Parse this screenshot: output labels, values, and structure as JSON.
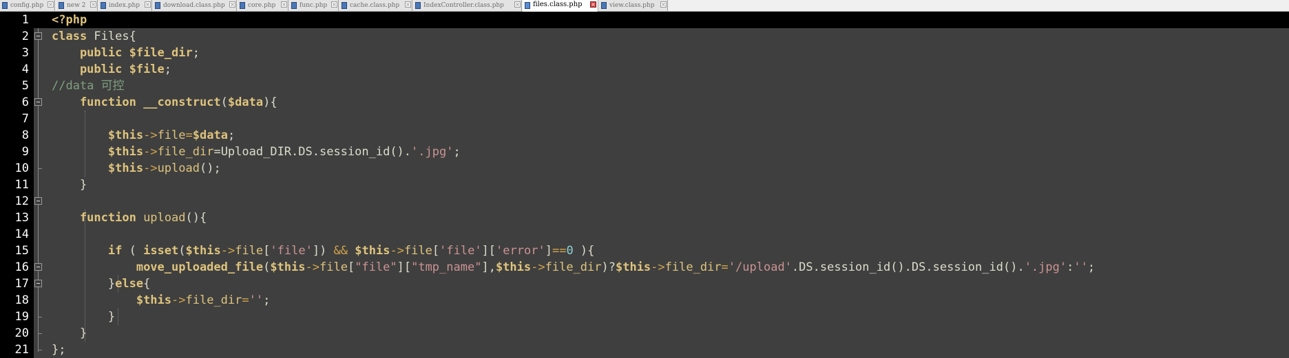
{
  "tabs": [
    {
      "label": "config.php",
      "active": false
    },
    {
      "label": "new 2",
      "active": false
    },
    {
      "label": "index.php",
      "active": false
    },
    {
      "label": "download.class.php",
      "active": false
    },
    {
      "label": "core.php",
      "active": false
    },
    {
      "label": "func.php",
      "active": false
    },
    {
      "label": "cache.class.php",
      "active": false
    },
    {
      "label": "IndexController.class.php",
      "active": false
    },
    {
      "label": "files.class.php",
      "active": true
    },
    {
      "label": "view.class.php",
      "active": false
    }
  ],
  "close_glyph": "×",
  "line_numbers": [
    "1",
    "2",
    "3",
    "4",
    "5",
    "6",
    "7",
    "8",
    "9",
    "10",
    "11",
    "12",
    "13",
    "14",
    "15",
    "16",
    "17",
    "18",
    "19",
    "20",
    "21"
  ],
  "code_lines": [
    [
      {
        "t": "<?php",
        "c": "kw"
      }
    ],
    [
      {
        "t": "class ",
        "c": "kw"
      },
      {
        "t": "Files{",
        "c": "plain"
      }
    ],
    [
      {
        "t": "    public ",
        "c": "kw"
      },
      {
        "t": "$file_dir",
        "c": "var"
      },
      {
        "t": ";",
        "c": "plain"
      }
    ],
    [
      {
        "t": "    public ",
        "c": "kw"
      },
      {
        "t": "$file",
        "c": "var"
      },
      {
        "t": ";",
        "c": "plain"
      }
    ],
    [
      {
        "t": "//data 可控",
        "c": "cmt"
      }
    ],
    [
      {
        "t": "    function ",
        "c": "kw"
      },
      {
        "t": "__construct",
        "c": "fn"
      },
      {
        "t": "(",
        "c": "plain"
      },
      {
        "t": "$data",
        "c": "var"
      },
      {
        "t": "){",
        "c": "plain"
      }
    ],
    [],
    [
      {
        "t": "        ",
        "c": "plain"
      },
      {
        "t": "$this",
        "c": "var"
      },
      {
        "t": "->",
        "c": "op"
      },
      {
        "t": "file",
        "c": "prop"
      },
      {
        "t": "=",
        "c": "op"
      },
      {
        "t": "$data",
        "c": "var"
      },
      {
        "t": ";",
        "c": "plain"
      }
    ],
    [
      {
        "t": "        ",
        "c": "plain"
      },
      {
        "t": "$this",
        "c": "var"
      },
      {
        "t": "->",
        "c": "op"
      },
      {
        "t": "file_dir",
        "c": "prop"
      },
      {
        "t": "=Upload_DIR.DS.session_id().",
        "c": "plain"
      },
      {
        "t": "'.jpg'",
        "c": "str"
      },
      {
        "t": ";",
        "c": "plain"
      }
    ],
    [
      {
        "t": "        ",
        "c": "plain"
      },
      {
        "t": "$this",
        "c": "var"
      },
      {
        "t": "->",
        "c": "op"
      },
      {
        "t": "upload",
        "c": "prop"
      },
      {
        "t": "();",
        "c": "plain"
      }
    ],
    [
      {
        "t": "    }",
        "c": "plain"
      }
    ],
    [],
    [
      {
        "t": "    function ",
        "c": "kw"
      },
      {
        "t": "upload",
        "c": "prop"
      },
      {
        "t": "(){",
        "c": "plain"
      }
    ],
    [],
    [
      {
        "t": "        if ",
        "c": "kw"
      },
      {
        "t": "( ",
        "c": "plain"
      },
      {
        "t": "isset",
        "c": "fn"
      },
      {
        "t": "(",
        "c": "plain"
      },
      {
        "t": "$this",
        "c": "var"
      },
      {
        "t": "->",
        "c": "op"
      },
      {
        "t": "file",
        "c": "prop"
      },
      {
        "t": "[",
        "c": "plain"
      },
      {
        "t": "'file'",
        "c": "str"
      },
      {
        "t": "]) ",
        "c": "plain"
      },
      {
        "t": "&&",
        "c": "op"
      },
      {
        "t": " ",
        "c": "plain"
      },
      {
        "t": "$this",
        "c": "var"
      },
      {
        "t": "->",
        "c": "op"
      },
      {
        "t": "file",
        "c": "prop"
      },
      {
        "t": "[",
        "c": "plain"
      },
      {
        "t": "'file'",
        "c": "str"
      },
      {
        "t": "][",
        "c": "plain"
      },
      {
        "t": "'error'",
        "c": "str"
      },
      {
        "t": "]",
        "c": "plain"
      },
      {
        "t": "==",
        "c": "op"
      },
      {
        "t": "0",
        "c": "num"
      },
      {
        "t": " ){",
        "c": "plain"
      }
    ],
    [
      {
        "t": "            ",
        "c": "plain"
      },
      {
        "t": "move_uploaded_file",
        "c": "fn"
      },
      {
        "t": "(",
        "c": "plain"
      },
      {
        "t": "$this",
        "c": "var"
      },
      {
        "t": "->",
        "c": "op"
      },
      {
        "t": "file",
        "c": "prop"
      },
      {
        "t": "[",
        "c": "plain"
      },
      {
        "t": "\"file\"",
        "c": "str"
      },
      {
        "t": "][",
        "c": "plain"
      },
      {
        "t": "\"tmp_name\"",
        "c": "str"
      },
      {
        "t": "],",
        "c": "plain"
      },
      {
        "t": "$this",
        "c": "var"
      },
      {
        "t": "->",
        "c": "op"
      },
      {
        "t": "file_dir",
        "c": "prop"
      },
      {
        "t": ")?",
        "c": "plain"
      },
      {
        "t": "$this",
        "c": "var"
      },
      {
        "t": "->",
        "c": "op"
      },
      {
        "t": "file_dir",
        "c": "prop"
      },
      {
        "t": "=",
        "c": "op"
      },
      {
        "t": "'/upload'",
        "c": "str"
      },
      {
        "t": ".DS.session_id().DS.session_id().",
        "c": "plain"
      },
      {
        "t": "'.jpg'",
        "c": "str"
      },
      {
        "t": ":",
        "c": "plain"
      },
      {
        "t": "''",
        "c": "str"
      },
      {
        "t": ";",
        "c": "plain"
      }
    ],
    [
      {
        "t": "        }",
        "c": "plain"
      },
      {
        "t": "else",
        "c": "kw"
      },
      {
        "t": "{",
        "c": "plain"
      }
    ],
    [
      {
        "t": "            ",
        "c": "plain"
      },
      {
        "t": "$this",
        "c": "var"
      },
      {
        "t": "->",
        "c": "op"
      },
      {
        "t": "file_dir",
        "c": "prop"
      },
      {
        "t": "=",
        "c": "op"
      },
      {
        "t": "''",
        "c": "str"
      },
      {
        "t": ";",
        "c": "plain"
      }
    ],
    [
      {
        "t": "        }",
        "c": "plain"
      }
    ],
    [
      {
        "t": "    }",
        "c": "plain"
      }
    ],
    [
      {
        "t": "};",
        "c": "plain"
      }
    ]
  ]
}
